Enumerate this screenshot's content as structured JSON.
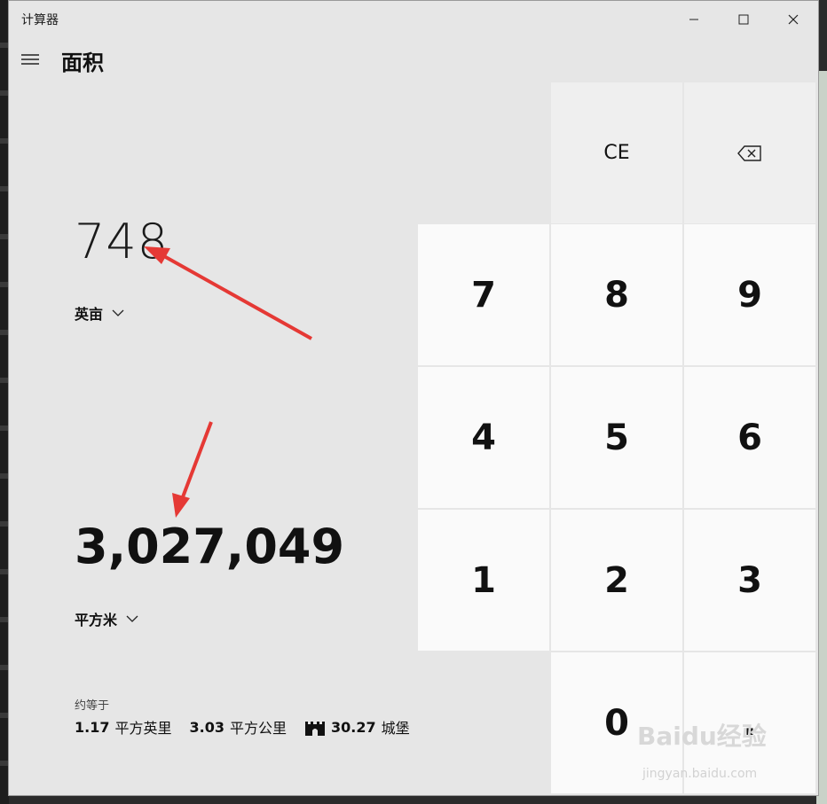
{
  "app": {
    "title": "计算器"
  },
  "header": {
    "title": "面积"
  },
  "converter": {
    "from_value": "748",
    "from_unit": "英亩",
    "to_value": "3,027,049",
    "to_unit": "平方米",
    "approx_label": "约等于",
    "approx": [
      {
        "value": "1.17",
        "unit": "平方英里"
      },
      {
        "value": "3.03",
        "unit": "平方公里"
      },
      {
        "value": "30.27",
        "unit": "城堡",
        "icon": "castle-icon"
      }
    ]
  },
  "keypad": {
    "ce": "CE",
    "backspace_icon": "backspace-icon",
    "keys": [
      "7",
      "8",
      "9",
      "4",
      "5",
      "6",
      "1",
      "2",
      "3",
      "0",
      "."
    ]
  },
  "annotations": {
    "arrow_color": "#e53935"
  },
  "watermark": {
    "text": "Baidu经验",
    "sub": "jingyan.baidu.com"
  }
}
